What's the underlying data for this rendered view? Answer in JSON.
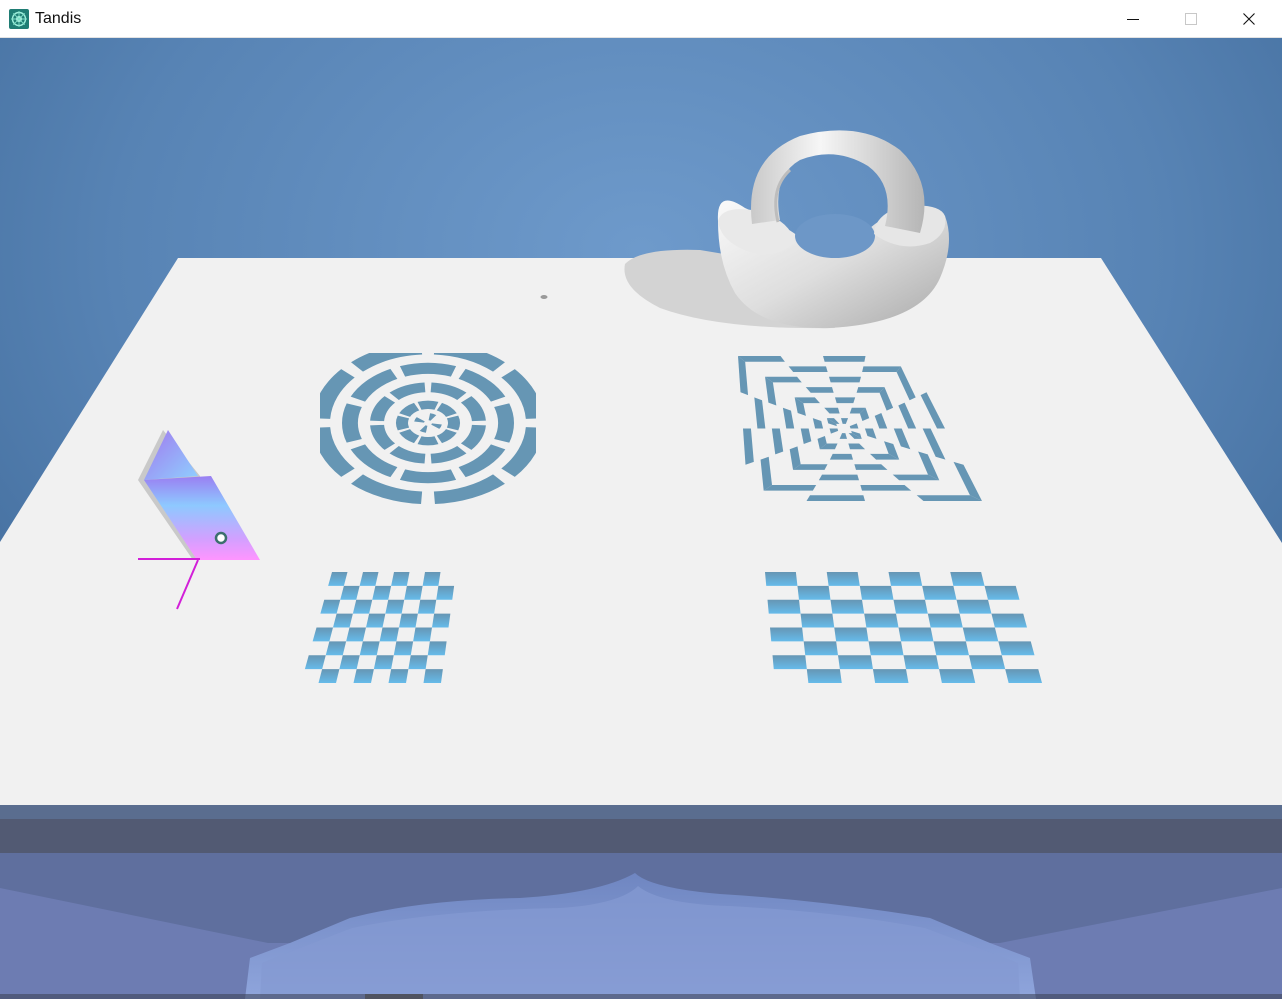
{
  "window": {
    "title": "Tandis",
    "controls": {
      "minimize_icon": "minimize-icon",
      "maximize_icon": "maximize-icon",
      "close_icon": "close-icon"
    }
  },
  "scene": {
    "colors": {
      "background_top": "#3f6e9c",
      "background_mid": "#6b97c6",
      "table_top": "#f1f1f1",
      "pattern_blue": "#6696b4",
      "pattern_light_blue": "#68b8e8",
      "gizmo_magenta": "#d21fd8",
      "cube_purple": "#a070ee",
      "cube_pink": "#ff9cff",
      "floor_blue": "#8aa2d6"
    },
    "objects": [
      "torus-cup",
      "concentric-ring-target",
      "square-spiral-target",
      "small-checkerboard",
      "large-checkerboard",
      "gradient-prism",
      "transform-gizmo"
    ]
  }
}
